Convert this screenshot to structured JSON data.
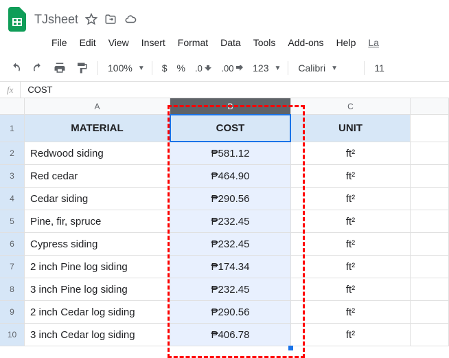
{
  "doc_title": "TJsheet",
  "menu": {
    "file": "File",
    "edit": "Edit",
    "view": "View",
    "insert": "Insert",
    "format": "Format",
    "data": "Data",
    "tools": "Tools",
    "addons": "Add-ons",
    "help": "Help",
    "last": "La"
  },
  "toolbar": {
    "zoom": "100%",
    "currency": "$",
    "percent": "%",
    "dec_dec": ".0",
    "inc_dec": ".00",
    "numfmt": "123",
    "font": "Calibri",
    "fontsize": "11"
  },
  "formula": "COST",
  "columns": {
    "a": "A",
    "b": "B",
    "c": "C"
  },
  "rows": [
    "1",
    "2",
    "3",
    "4",
    "5",
    "6",
    "7",
    "8",
    "9",
    "10"
  ],
  "headers": {
    "material": "MATERIAL",
    "cost": "COST",
    "unit": "UNIT"
  },
  "data": [
    {
      "material": "Redwood siding",
      "cost": "₱581.12",
      "unit": "ft²"
    },
    {
      "material": "Red cedar",
      "cost": "₱464.90",
      "unit": "ft²"
    },
    {
      "material": "Cedar siding",
      "cost": "₱290.56",
      "unit": "ft²"
    },
    {
      "material": "Pine, fir, spruce",
      "cost": "₱232.45",
      "unit": "ft²"
    },
    {
      "material": "Cypress siding",
      "cost": "₱232.45",
      "unit": "ft²"
    },
    {
      "material": "2 inch Pine log siding",
      "cost": "₱174.34",
      "unit": "ft²"
    },
    {
      "material": "3 inch Pine log siding",
      "cost": "₱232.45",
      "unit": "ft²"
    },
    {
      "material": "2 inch Cedar log siding",
      "cost": "₱290.56",
      "unit": "ft²"
    },
    {
      "material": "3 inch Cedar log siding",
      "cost": "₱406.78",
      "unit": "ft²"
    }
  ]
}
